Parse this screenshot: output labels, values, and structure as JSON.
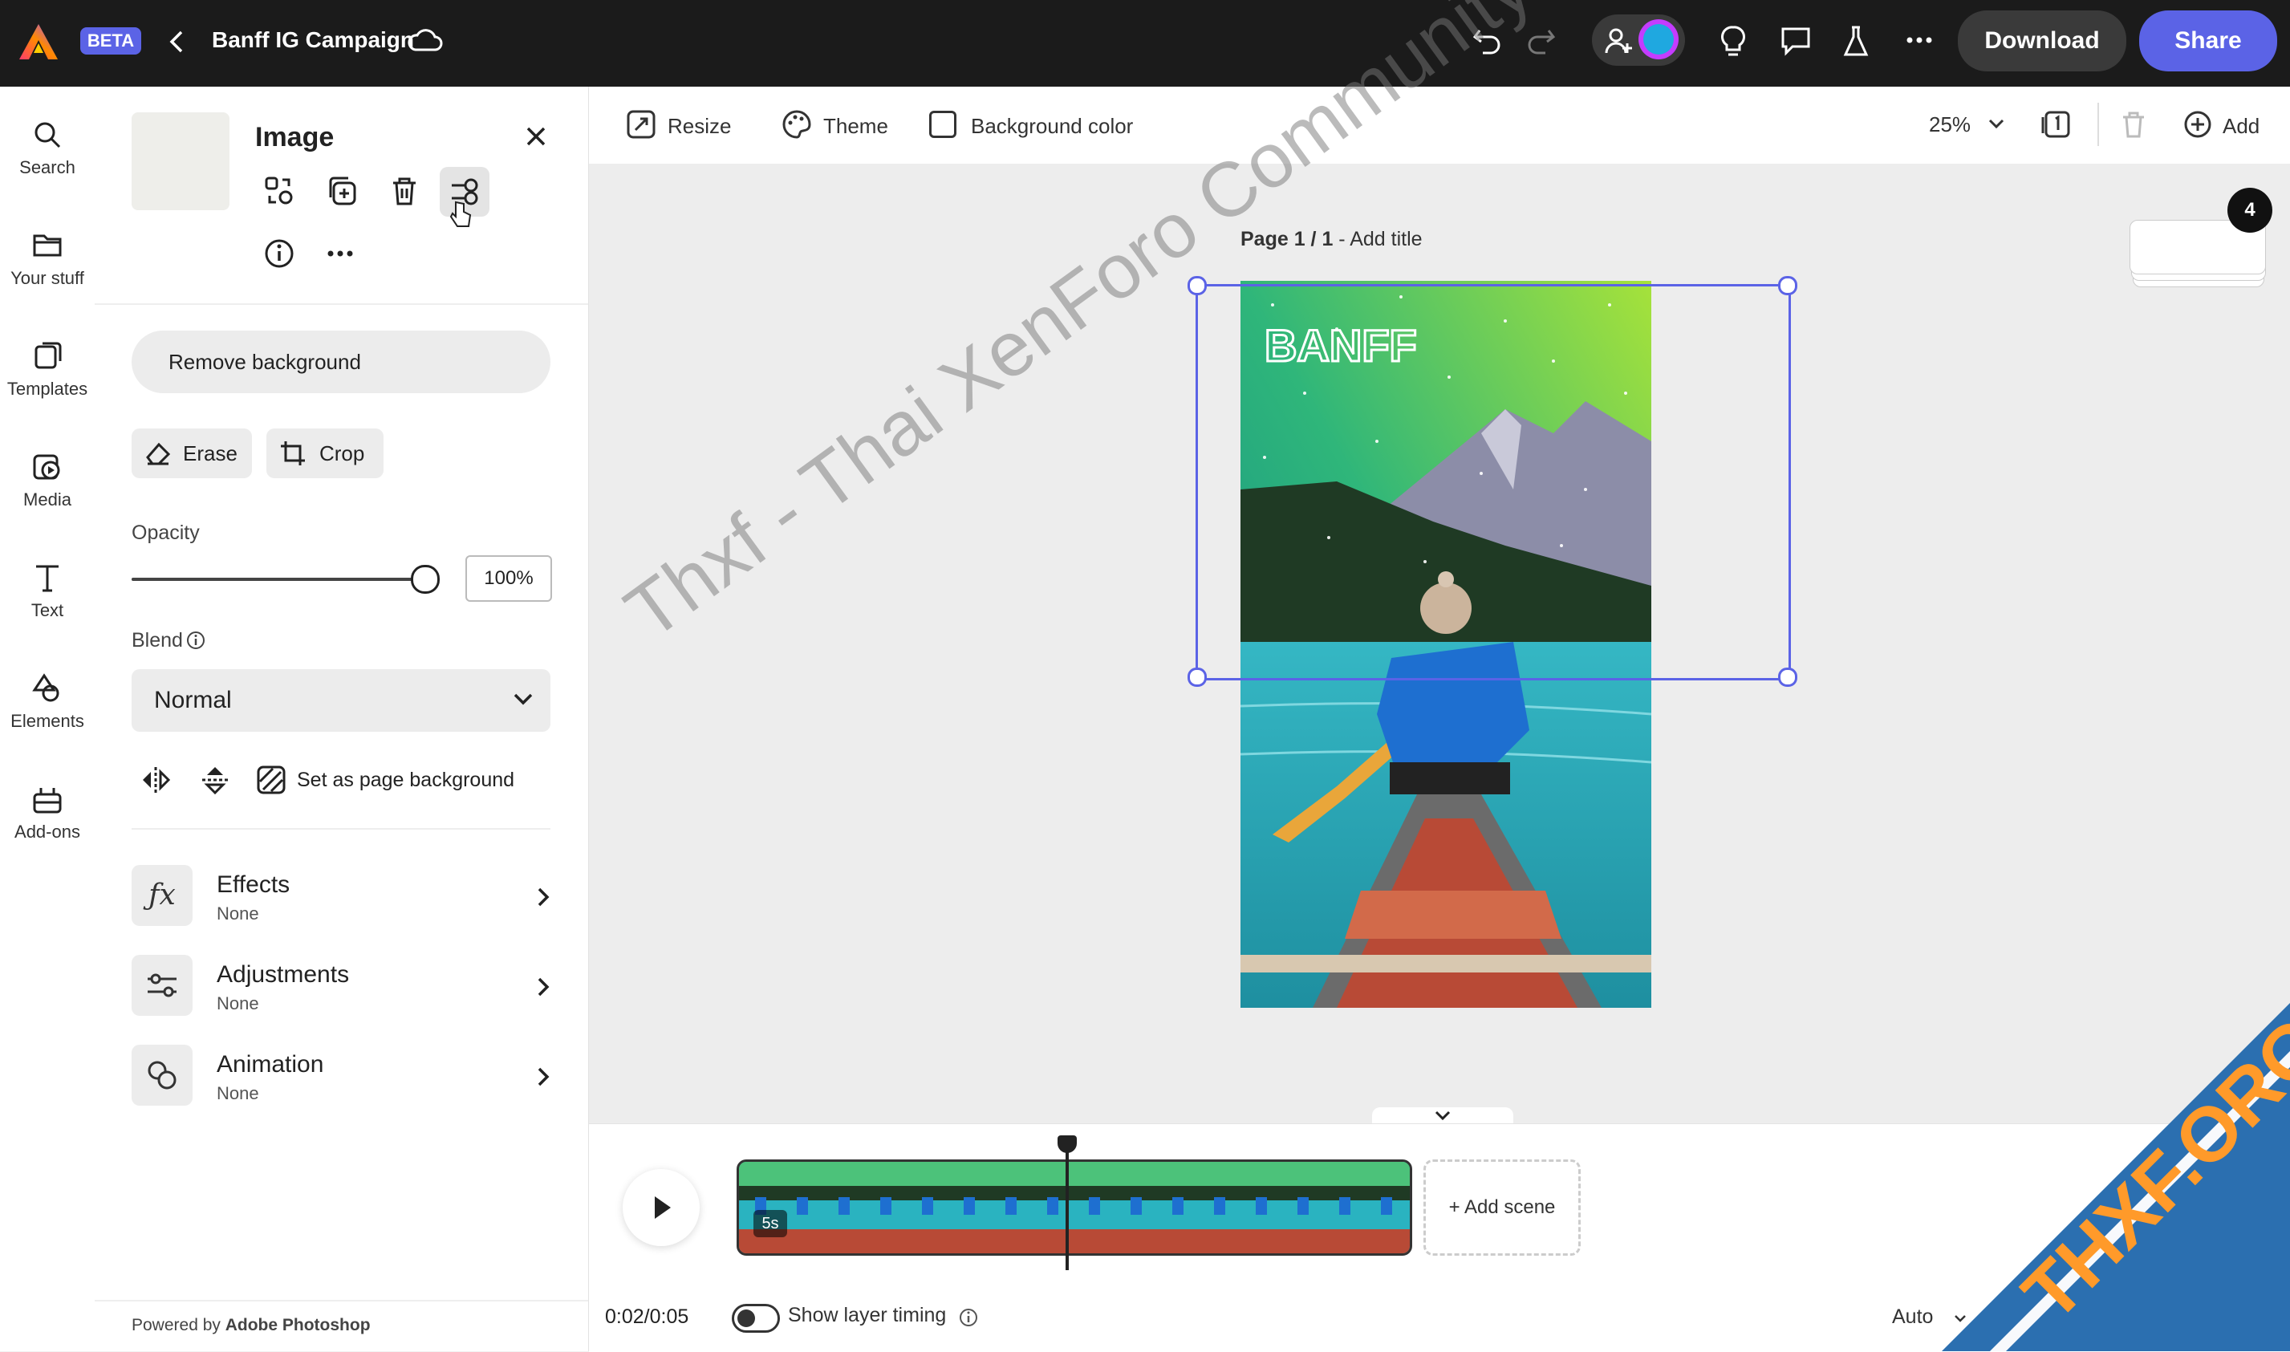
{
  "topbar": {
    "beta_label": "BETA",
    "project_title": "Banff IG Campaign",
    "download_label": "Download",
    "share_label": "Share",
    "colors": {
      "bg": "#1b1b1b",
      "download_bg": "#3a3a3a",
      "share_bg": "#5b63e6"
    }
  },
  "rail": {
    "items": [
      {
        "label": "Search",
        "icon": "search-icon"
      },
      {
        "label": "Your stuff",
        "icon": "folder-icon"
      },
      {
        "label": "Templates",
        "icon": "templates-icon"
      },
      {
        "label": "Media",
        "icon": "media-icon"
      },
      {
        "label": "Text",
        "icon": "text-icon"
      },
      {
        "label": "Elements",
        "icon": "elements-icon"
      },
      {
        "label": "Add-ons",
        "icon": "addons-icon"
      }
    ]
  },
  "panel": {
    "title": "Image",
    "remove_background_label": "Remove background",
    "erase_label": "Erase",
    "crop_label": "Crop",
    "opacity_label": "Opacity",
    "opacity_value": "100%",
    "opacity_fraction": 1.0,
    "blend_label": "Blend",
    "blend_value": "Normal",
    "set_page_bg_label": "Set as page background",
    "sections": [
      {
        "title": "Effects",
        "value": "None",
        "icon": "fx-icon"
      },
      {
        "title": "Adjustments",
        "value": "None",
        "icon": "adjustments-icon"
      },
      {
        "title": "Animation",
        "value": "None",
        "icon": "animation-icon"
      }
    ],
    "powered_prefix": "Powered by ",
    "powered_brand": "Adobe Photoshop"
  },
  "toolbar": {
    "resize_label": "Resize",
    "theme_label": "Theme",
    "background_color_label": "Background color",
    "zoom_value": "25%",
    "add_label": "Add"
  },
  "canvas": {
    "page_label": "Page 1 / 1",
    "page_title_placeholder": "Add title",
    "page_count_badge": "4",
    "selection_color": "#5b63e6",
    "image_logo_text": "BANFF"
  },
  "timeline": {
    "scene_duration": "5s",
    "add_scene_label": "+ Add scene",
    "time_current": "0:02",
    "time_total": "/0:05",
    "show_layer_timing_label": "Show layer timing",
    "auto_label": "Auto"
  },
  "watermark": {
    "diagonal_text": "Thxf - Thai XenForo Community",
    "corner_text": "THXF.ORG",
    "corner_color": "#2b6fb0"
  }
}
